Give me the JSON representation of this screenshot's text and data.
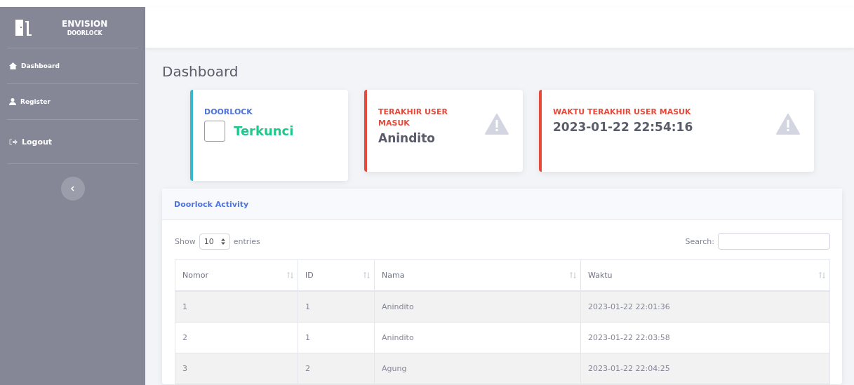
{
  "brand": {
    "title": "ENVISION",
    "subtitle": "DOORLOCK"
  },
  "sidebar": {
    "items": [
      {
        "label": "Dashboard",
        "kind": "home"
      },
      {
        "label": "Register",
        "kind": "user"
      },
      {
        "label": "Logout",
        "kind": "logout"
      }
    ]
  },
  "page_title": "Dashboard",
  "cards": [
    {
      "kind": "lock",
      "label": "DOORLOCK",
      "value": "Terkunci",
      "checked": false,
      "color": "#36b9cc"
    },
    {
      "kind": "warn",
      "label": "TERAKHIR USER MASUK",
      "value": "Anindito",
      "color": "#e74a3b"
    },
    {
      "kind": "warn",
      "label": "WAKTU TERAKHIR USER MASUK",
      "value": "2023-01-22 22:54:16",
      "color": "#e74a3b"
    }
  ],
  "table_card": {
    "title": "Doorlock Activity",
    "show_label": "Show",
    "page_size": "10",
    "entries_label": "entries",
    "search_label": "Search:",
    "columns": [
      "Nomor",
      "ID",
      "Nama",
      "Waktu"
    ],
    "rows": [
      [
        "1",
        "1",
        "Anindito",
        "2023-01-22 22:01:36"
      ],
      [
        "2",
        "1",
        "Anindito",
        "2023-01-22 22:03:58"
      ],
      [
        "3",
        "2",
        "Agung",
        "2023-01-22 22:04:25"
      ]
    ]
  }
}
